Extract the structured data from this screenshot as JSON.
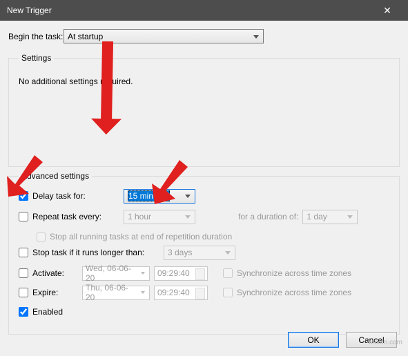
{
  "titlebar": {
    "title": "New Trigger"
  },
  "begin": {
    "label": "Begin the task:",
    "value": "At startup"
  },
  "settings_group": {
    "legend": "Settings",
    "text": "No additional settings required."
  },
  "advanced": {
    "legend": "Advanced settings",
    "delay": {
      "checked": true,
      "label": "Delay task for:",
      "value": "15 minutes"
    },
    "repeat": {
      "checked": false,
      "label": "Repeat task every:",
      "value": "1 hour",
      "duration_label": "for a duration of:",
      "duration_value": "1 day"
    },
    "stop_all": {
      "checked": false,
      "label": "Stop all running tasks at end of repetition duration"
    },
    "stop_longer": {
      "checked": false,
      "label": "Stop task if it runs longer than:",
      "value": "3 days"
    },
    "activate": {
      "checked": false,
      "label": "Activate:",
      "date": "Wed, 06-06-20",
      "time": "09:29:40",
      "sync": "Synchronize across time zones"
    },
    "expire": {
      "checked": false,
      "label": "Expire:",
      "date": "Thu, 06-06-20",
      "time": "09:29:40",
      "sync": "Synchronize across time zones"
    },
    "enabled": {
      "checked": true,
      "label": "Enabled"
    }
  },
  "buttons": {
    "ok": "OK",
    "cancel": "Cancel"
  },
  "watermark": "wsxdn.com"
}
